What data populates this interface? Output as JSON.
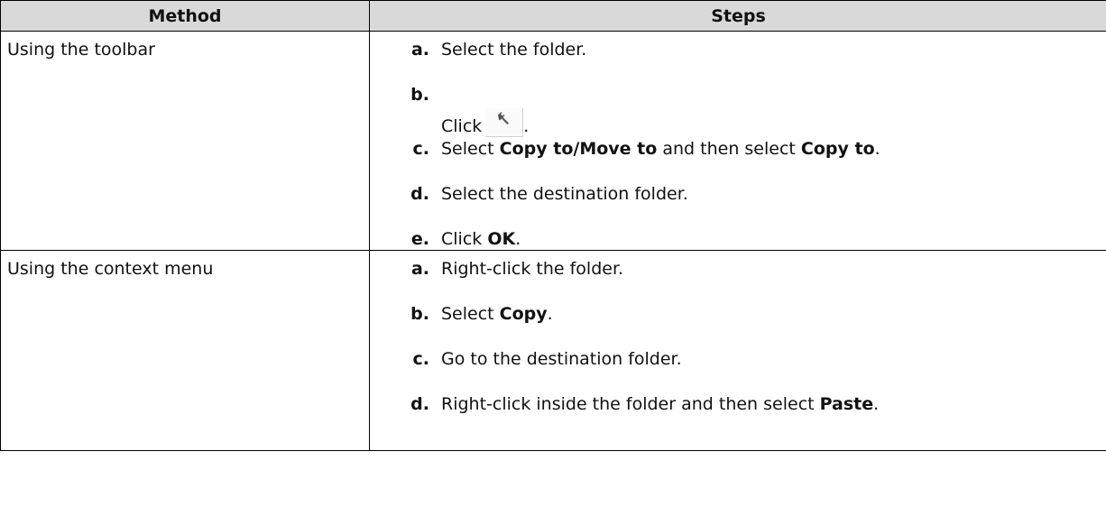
{
  "table": {
    "headers": [
      "Method",
      "Steps"
    ],
    "rows": [
      {
        "method": "Using the toolbar",
        "steps": [
          {
            "letter": "a.",
            "text": "Select the folder."
          },
          {
            "letter": "b.",
            "pre": "Click",
            "icon": "wrench-icon",
            "post": "."
          },
          {
            "letter": "c.",
            "pre": "Select ",
            "bold1": "Copy to/Move to",
            "mid": " and then select ",
            "bold2": "Copy to",
            "post": "."
          },
          {
            "letter": "d.",
            "text": "Select the destination folder."
          },
          {
            "letter": "e.",
            "pre": "Click ",
            "bold1": "OK",
            "post": "."
          }
        ]
      },
      {
        "method": "Using the context menu",
        "steps": [
          {
            "letter": "a.",
            "text": "Right-click the folder."
          },
          {
            "letter": "b.",
            "pre": "Select ",
            "bold1": "Copy",
            "post": "."
          },
          {
            "letter": "c.",
            "text": "Go to the destination folder."
          },
          {
            "letter": "d.",
            "pre": "Right-click inside the folder and then select ",
            "bold1": "Paste",
            "post": "."
          }
        ]
      }
    ]
  }
}
